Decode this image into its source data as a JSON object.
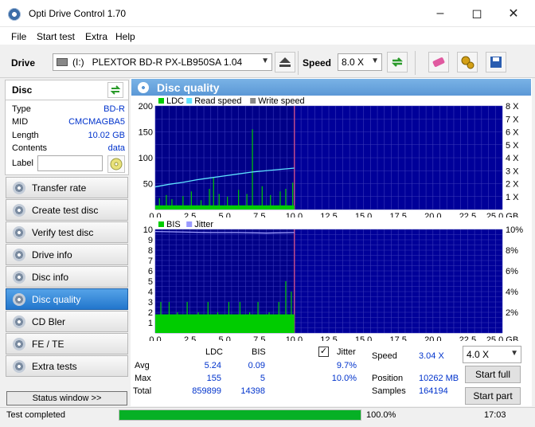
{
  "window": {
    "title": "Opti Drive Control 1.70"
  },
  "menu": [
    "File",
    "Start test",
    "Extra",
    "Help"
  ],
  "toolbar": {
    "drive_label": "Drive",
    "drive_letter": "(I:)",
    "drive_name": "PLEXTOR BD-R  PX-LB950SA 1.04",
    "speed_label": "Speed",
    "speed_value": "8.0 X"
  },
  "disc": {
    "header": "Disc",
    "type_label": "Type",
    "type_value": "BD-R",
    "mid_label": "MID",
    "mid_value": "CMCMAGBA5",
    "length_label": "Length",
    "length_value": "10.02 GB",
    "contents_label": "Contents",
    "contents_value": "data",
    "label_label": "Label",
    "label_value": ""
  },
  "nav": [
    {
      "label": "Transfer rate",
      "active": false
    },
    {
      "label": "Create test disc",
      "active": false
    },
    {
      "label": "Verify test disc",
      "active": false
    },
    {
      "label": "Drive info",
      "active": false
    },
    {
      "label": "Disc info",
      "active": false
    },
    {
      "label": "Disc quality",
      "active": true
    },
    {
      "label": "CD Bler",
      "active": false
    },
    {
      "label": "FE / TE",
      "active": false
    },
    {
      "label": "Extra tests",
      "active": false
    }
  ],
  "status_window_label": "Status window >>",
  "section_title": "Disc quality",
  "chart_data": [
    {
      "type": "line",
      "legend": [
        "LDC",
        "Read speed",
        "Write speed"
      ],
      "x_ticks": [
        "0.0",
        "2.5",
        "5.0",
        "7.5",
        "10.0",
        "12.5",
        "15.0",
        "17.5",
        "20.0",
        "22.5",
        "25.0 GB"
      ],
      "y_ticks_left": [
        "200",
        "150",
        "100",
        "50"
      ],
      "y_ticks_right": [
        "8 X",
        "7 X",
        "6 X",
        "5 X",
        "4 X",
        "3 X",
        "2 X",
        "1 X"
      ],
      "xlim": [
        0,
        25
      ],
      "ylim": [
        0,
        200
      ],
      "y2lim": [
        0,
        8
      ],
      "data_end": 10.02,
      "series": [
        {
          "name": "LDC",
          "color": "#00cc00",
          "x": [
            0.3,
            0.8,
            1.2,
            2.0,
            2.6,
            3.3,
            3.9,
            4.2,
            4.6,
            5.2,
            6.0,
            6.6,
            7.0,
            7.7,
            8.3,
            9.0,
            9.4,
            9.9
          ],
          "values": [
            22,
            28,
            20,
            26,
            35,
            18,
            40,
            62,
            30,
            25,
            38,
            30,
            155,
            45,
            28,
            35,
            40,
            52
          ]
        },
        {
          "name": "Read speed",
          "color": "#5fe3ff",
          "x": [
            0,
            1,
            2,
            3,
            4,
            5,
            6,
            7,
            8,
            9,
            10.02
          ],
          "values": [
            1.75,
            1.95,
            2.1,
            2.3,
            2.45,
            2.6,
            2.75,
            2.9,
            3.0,
            3.1,
            3.2
          ]
        }
      ]
    },
    {
      "type": "bar",
      "legend": [
        "BIS",
        "Jitter"
      ],
      "x_ticks": [
        "0.0",
        "2.5",
        "5.0",
        "7.5",
        "10.0",
        "12.5",
        "15.0",
        "17.5",
        "20.0",
        "22.5",
        "25.0 GB"
      ],
      "y_ticks_left": [
        "10",
        "9",
        "8",
        "7",
        "6",
        "5",
        "4",
        "3",
        "2",
        "1"
      ],
      "y_ticks_right": [
        "10%",
        "8%",
        "6%",
        "4%",
        "2%"
      ],
      "xlim": [
        0,
        25
      ],
      "ylim": [
        0,
        10
      ],
      "y2lim": [
        0,
        10
      ],
      "data_end": 10.02,
      "series": [
        {
          "name": "BIS",
          "color": "#00cc00",
          "x": [
            0.4,
            1.0,
            1.6,
            2.3,
            3.1,
            3.8,
            4.5,
            5.3,
            6.1,
            6.8,
            7.4,
            8.2,
            8.9,
            9.4,
            9.8
          ],
          "values": [
            3,
            3,
            2,
            3,
            2,
            3,
            2,
            3,
            3,
            2,
            3,
            2,
            3,
            5,
            4
          ]
        },
        {
          "name": "Jitter",
          "color": "#7070ff",
          "x": [
            0,
            2,
            4,
            6,
            8,
            10.02
          ],
          "values": [
            9.8,
            9.75,
            9.7,
            9.7,
            9.65,
            9.7
          ]
        }
      ]
    }
  ],
  "stats": {
    "col_ldc": "LDC",
    "col_bis": "BIS",
    "jitter_label": "Jitter",
    "jitter_checked": true,
    "avg_label": "Avg",
    "avg_ldc": "5.24",
    "avg_bis": "0.09",
    "avg_jitter": "9.7%",
    "max_label": "Max",
    "max_ldc": "155",
    "max_bis": "5",
    "max_jitter": "10.0%",
    "total_label": "Total",
    "total_ldc": "859899",
    "total_bis": "14398",
    "speed_label": "Speed",
    "speed_value": "3.04 X",
    "position_label": "Position",
    "position_value": "10262 MB",
    "samples_label": "Samples",
    "samples_value": "164194",
    "speed_select": "4.0 X",
    "start_full": "Start full",
    "start_part": "Start part"
  },
  "statusbar": {
    "status": "Test completed",
    "progress": 100,
    "progress_label": "100.0%",
    "time": "17:03"
  },
  "colors": {
    "plot_bg": "#000099",
    "grid": "#3a3ab8",
    "accent_blue": "#0033cc",
    "progress": "#06b025"
  }
}
